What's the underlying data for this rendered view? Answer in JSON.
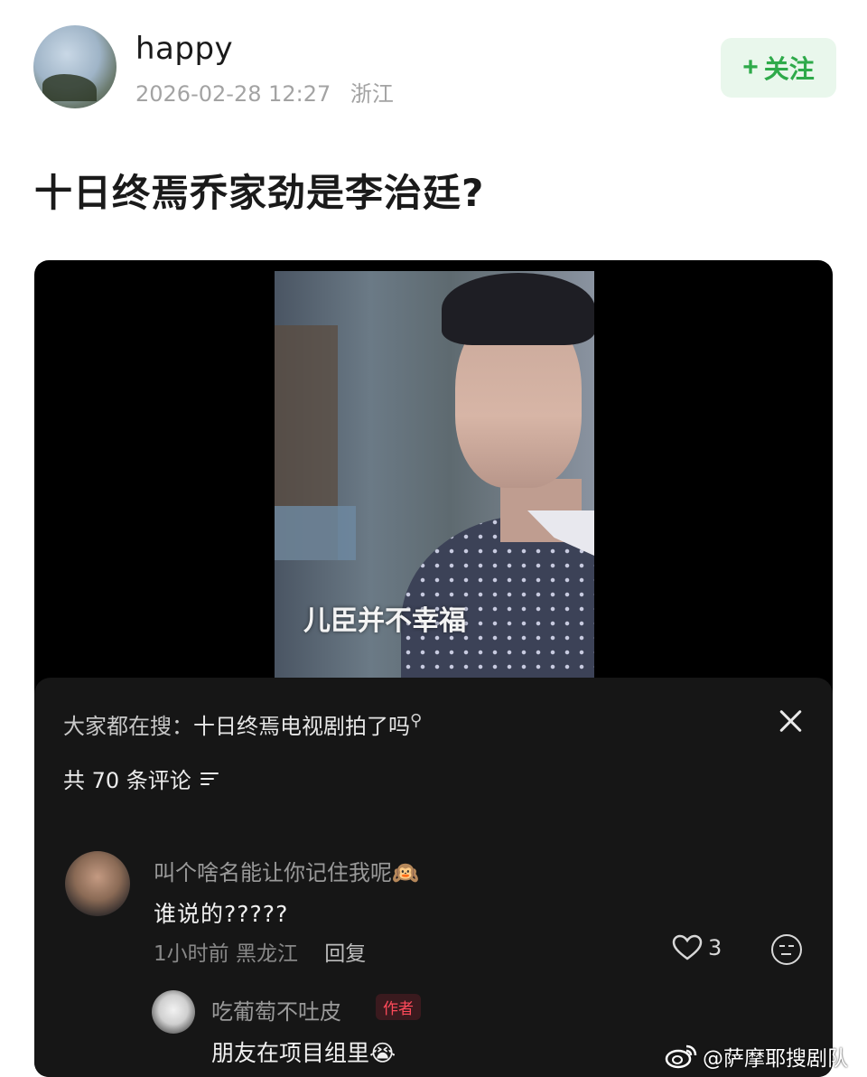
{
  "post": {
    "username": "happy",
    "timestamp": "2026-02-28 12:27",
    "location": "浙江",
    "follow_label": "关注",
    "follow_plus": "+",
    "title": "十日终焉乔家劲是李治廷?"
  },
  "video": {
    "subtitle": "儿臣并不幸福"
  },
  "comments_panel": {
    "search_prefix": "大家都在搜：",
    "search_term": "十日终焉电视剧拍了吗",
    "search_icon": "magnifier-icon",
    "count_text": "共 70 条评论",
    "comments": [
      {
        "name": "叫个啥名能让你记住我呢🙉",
        "text": "谁说的?????",
        "time": "1小时前",
        "location": "黑龙江",
        "reply_label": "回复",
        "likes": "3"
      },
      {
        "name": "吃葡萄不吐皮",
        "badge": "作者",
        "text": "朋友在项目组里😭"
      }
    ]
  },
  "watermark": {
    "text": "@萨摩耶搜剧队"
  },
  "colors": {
    "accent_green": "#2eaa4a",
    "follow_bg": "#e9f7ec",
    "author_red": "#ff4a5a",
    "panel_bg": "#161616"
  }
}
